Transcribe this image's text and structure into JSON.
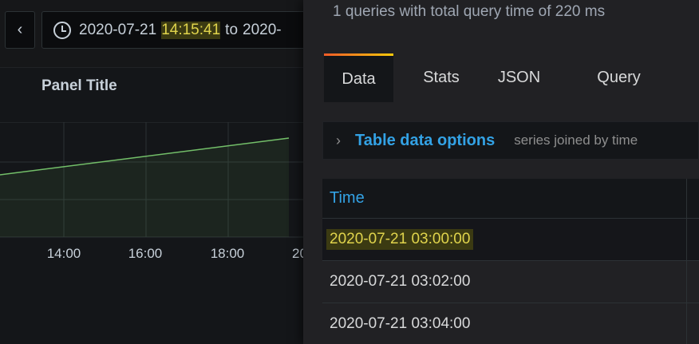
{
  "dashboard": {
    "nav_back_glyph": "‹",
    "time_range": {
      "from_date": "2020-07-21",
      "from_time": "14:15:41",
      "separator": "to",
      "to_partial": "2020-"
    },
    "panel": {
      "title": "Panel Title",
      "x_ticks": [
        "14:00",
        "16:00",
        "18:00",
        "20"
      ],
      "series_color": "#73bf69"
    }
  },
  "inspector": {
    "query_info": "1 queries with total query time of 220 ms",
    "tabs": [
      {
        "label": "Data",
        "active": true
      },
      {
        "label": "Stats",
        "active": false
      },
      {
        "label": "JSON",
        "active": false
      },
      {
        "label": "Query",
        "active": false
      }
    ],
    "options": {
      "chevron_glyph": "›",
      "title": "Table data options",
      "description": "series joined by time"
    },
    "table": {
      "column": "Time",
      "rows": [
        "2020-07-21 03:00:00",
        "2020-07-21 03:02:00",
        "2020-07-21 03:04:00"
      ]
    }
  },
  "colors": {
    "accent_blue": "#33a2e5",
    "highlight_text": "#e0d44c",
    "highlight_bg": "#3b3a12",
    "tab_gradient": [
      "#f05a28",
      "#fbca0a"
    ]
  }
}
